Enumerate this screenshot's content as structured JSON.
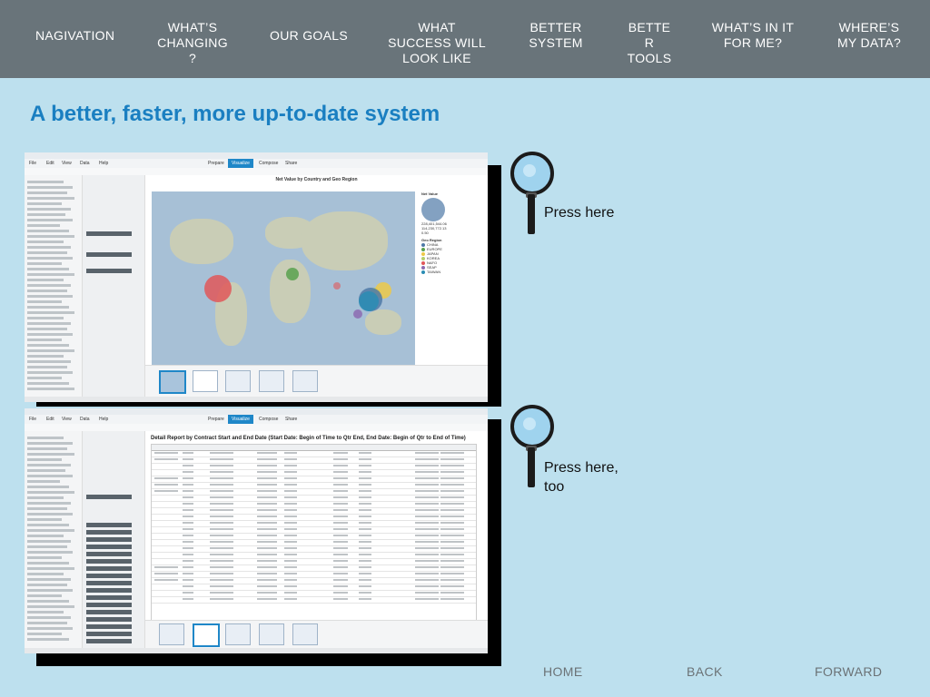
{
  "nav": {
    "items": [
      {
        "label": "NAGIVATION"
      },
      {
        "label": "WHAT’S\nCHANGING\n?"
      },
      {
        "label": "OUR GOALS"
      },
      {
        "label": "WHAT\nSUCCESS WILL\nLOOK LIKE"
      },
      {
        "label": "BETTER\nSYSTEM"
      },
      {
        "label": "BETTE\nR\nTOOLS"
      },
      {
        "label": "WHAT’S IN IT\nFOR ME?"
      },
      {
        "label": "WHERE’S\nMY DATA?"
      }
    ]
  },
  "headline": "A better, faster, more up-to-date system",
  "screenshot1": {
    "menus": [
      "File",
      "Edit",
      "View",
      "Data",
      "Help"
    ],
    "tabs": [
      "Prepare",
      "Visualize",
      "Compose",
      "Share"
    ],
    "active_tab": "Visualize",
    "chart_title": "Net Value by Country and Geo Region",
    "legend_title": "Net Value",
    "legend_values": [
      "228,401,544.06",
      "114,230,772.13",
      "0.50"
    ],
    "geo_title": "Geo Region",
    "geo_regions": [
      {
        "name": "CHINA",
        "color": "#4e79a7"
      },
      {
        "name": "EUROPE",
        "color": "#59a14f"
      },
      {
        "name": "JAPAN",
        "color": "#edc948"
      },
      {
        "name": "KOREA",
        "color": "#b5cf6b"
      },
      {
        "name": "NAFO",
        "color": "#e15759"
      },
      {
        "name": "SEAP",
        "color": "#8c6bb1"
      },
      {
        "name": "TAIWAN",
        "color": "#2a8cb4"
      }
    ]
  },
  "screenshot2": {
    "menus": [
      "File",
      "Edit",
      "View",
      "Data",
      "Help"
    ],
    "tabs": [
      "Prepare",
      "Visualize",
      "Compose",
      "Share"
    ],
    "active_tab": "Visualize",
    "report_title": "Detail Report by Contract Start and End Date (Start Date: Begin of Time to Qtr End, End Date: Begin of Qtr to End of Time)"
  },
  "callouts": {
    "first": "Press here",
    "second": "Press here,\ntoo"
  },
  "footer": {
    "home": "HOME",
    "back": "BACK",
    "forward": "FORWARD"
  },
  "colors": {
    "nav_bg": "#69747a",
    "page_bg": "#bde0ee",
    "headline": "#1a7fc1",
    "accent_tab": "#1f87c8"
  }
}
